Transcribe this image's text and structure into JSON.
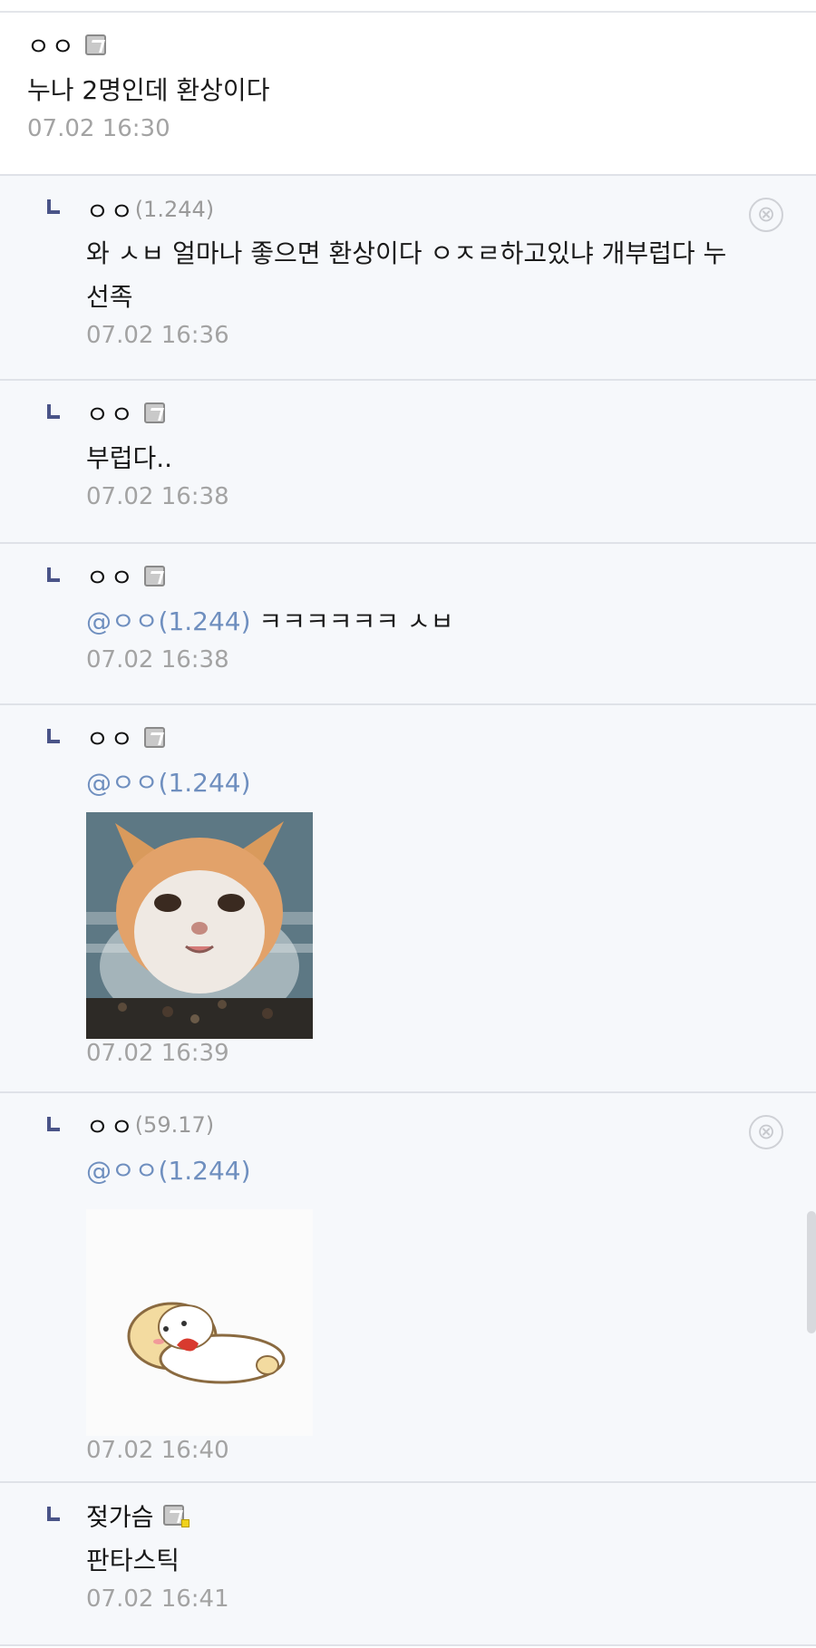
{
  "comments": [
    {
      "nick": "ㅇㅇ",
      "ip": "",
      "text": "누나 2명인데 환상이다",
      "date": "07.02 16:30"
    },
    {
      "nick": "ㅇㅇ",
      "ip": "(1.244)",
      "text": "와 ㅅㅂ 얼마나 좋으면 환상이다 ㅇㅈㄹ하고있냐 개부럽다 누",
      "text2": "선족",
      "date": "07.02 16:36"
    },
    {
      "nick": "ㅇㅇ",
      "ip": "",
      "text": "부럽다..",
      "date": "07.02 16:38"
    },
    {
      "nick": "ㅇㅇ",
      "ip": "",
      "mention": "@ㅇㅇ(1.244)",
      "text": " ㅋㅋㅋㅋㅋㅋ ㅅㅂ",
      "date": "07.02 16:38"
    },
    {
      "nick": "ㅇㅇ",
      "ip": "",
      "mention": "@ㅇㅇ(1.244)",
      "date": "07.02 16:39"
    },
    {
      "nick": "ㅇㅇ",
      "ip": "(59.17)",
      "mention": "@ㅇㅇ(1.244)",
      "date": "07.02 16:40"
    },
    {
      "nick": "젖가슴",
      "ip": "",
      "text": "판타스틱",
      "date": "07.02 16:41"
    }
  ],
  "icons": {
    "delete": "⊗",
    "gallog": "gallog-icon",
    "reply": "reply-arrow-icon"
  },
  "colors": {
    "mention": "#6f8fbf",
    "reply_background": "#f6f8fb",
    "reply_mark": "#4a5488"
  }
}
